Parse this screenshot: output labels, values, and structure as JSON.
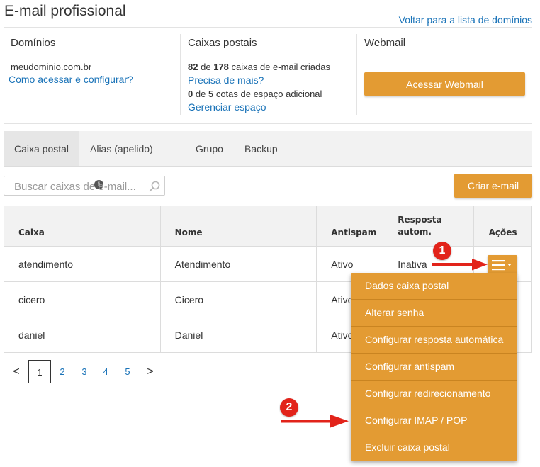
{
  "header": {
    "title": "E-mail profissional",
    "back_link": "Voltar para a lista de domínios"
  },
  "summary": {
    "domains": {
      "heading": "Domínios",
      "domain": "meudominio.com.br",
      "help_link": "Como acessar e configurar?"
    },
    "mailboxes": {
      "heading": "Caixas postais",
      "created": "82",
      "of_word": "de",
      "total": "178",
      "created_suffix": "caixas de e-mail criadas",
      "more_link": "Precisa de mais?",
      "extra_used": "0",
      "extra_total": "5",
      "extra_suffix": "cotas de espaço adicional",
      "manage_link": "Gerenciar espaço"
    },
    "webmail": {
      "heading": "Webmail",
      "button": "Acessar Webmail"
    }
  },
  "tabs": [
    {
      "label": "Caixa postal",
      "active": true
    },
    {
      "label": "Alias (apelido)",
      "icon": "info-icon",
      "icon_glyph": "i"
    },
    {
      "label": "Grupo"
    },
    {
      "label": "Backup"
    }
  ],
  "search": {
    "placeholder": "Buscar caixas de e-mail...",
    "icon": "search-icon"
  },
  "create_button": "Criar e-mail",
  "table": {
    "columns": [
      "Caixa",
      "Nome",
      "Antispam",
      "Resposta autom.",
      "Ações"
    ],
    "rows": [
      {
        "caixa": "atendimento",
        "nome": "Atendimento",
        "antispam": "Ativo",
        "resposta": "Inativa"
      },
      {
        "caixa": "cicero",
        "nome": "Cicero",
        "antispam": "Ativo",
        "resposta": ""
      },
      {
        "caixa": "daniel",
        "nome": "Daniel",
        "antispam": "Ativo",
        "resposta": ""
      }
    ]
  },
  "pagination": {
    "prev": "<",
    "next": ">",
    "pages": [
      "1",
      "2",
      "3",
      "4",
      "5"
    ],
    "current": "1"
  },
  "actions_menu": {
    "items": [
      "Dados caixa postal",
      "Alterar senha",
      "Configurar resposta automática",
      "Configurar antispam",
      "Configurar redirecionamento",
      "Configurar IMAP / POP",
      "Excluir caixa postal"
    ]
  },
  "annotations": {
    "badge_1": "1",
    "badge_2": "2"
  },
  "colors": {
    "accent_orange": "#e39b33",
    "link_blue": "#1a73b8",
    "annotation_red": "#e2231a"
  }
}
